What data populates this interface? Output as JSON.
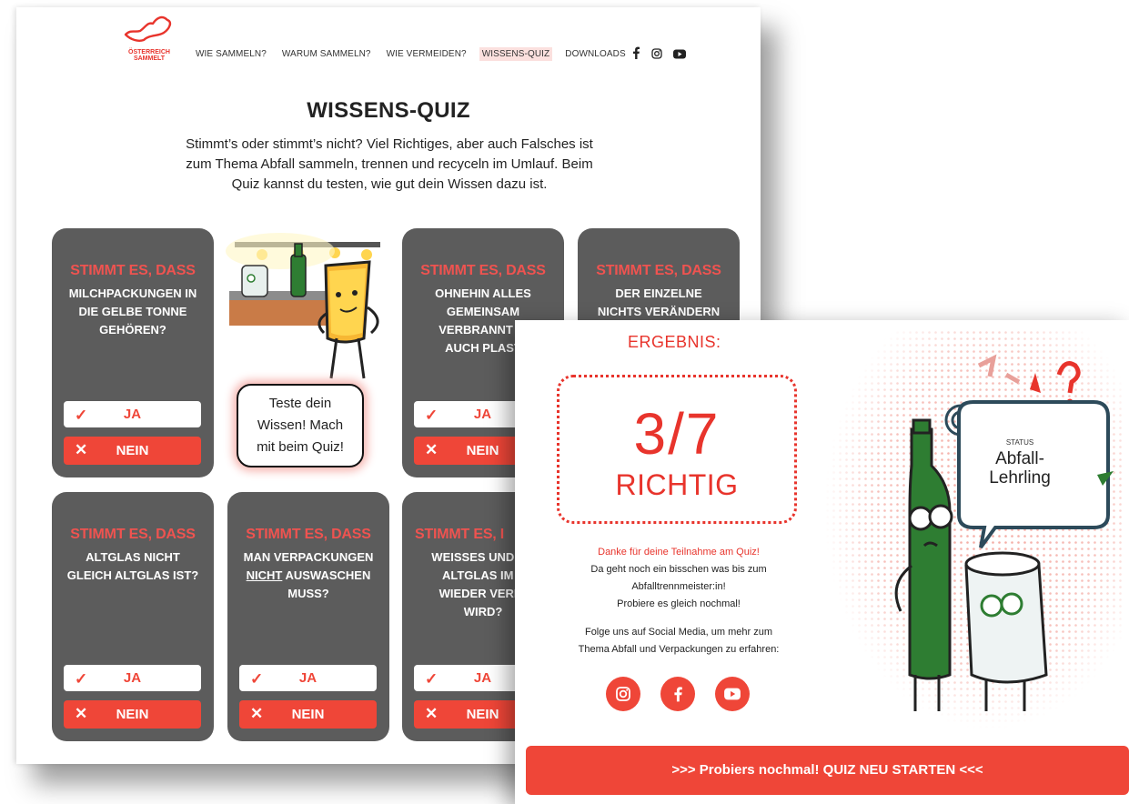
{
  "site": {
    "logo_text_line1": "ÖSTERREICH",
    "logo_text_line2": "SAMMELT",
    "nav": [
      {
        "label": "WIE SAMMELN?",
        "active": false
      },
      {
        "label": "WARUM SAMMELN?",
        "active": false
      },
      {
        "label": "WIE VERMEIDEN?",
        "active": false
      },
      {
        "label": "WISSENS-QUIZ",
        "active": true
      },
      {
        "label": "DOWNLOADS",
        "active": false
      }
    ],
    "social_icons": [
      "facebook-icon",
      "instagram-icon",
      "youtube-icon"
    ]
  },
  "page": {
    "title": "WISSENS-QUIZ",
    "intro_lines": [
      "Stimmt’s oder stimmt’s nicht? Viel Richtiges, aber auch Falsches ist",
      "zum Thema Abfall sammeln, trennen und recyceln im Umlauf. Beim",
      "Quiz kannst du testen, wie gut dein Wissen dazu ist."
    ],
    "kicker": "STIMMT ES, DASS",
    "yes_label": "JA",
    "no_label": "NEIN",
    "cards": [
      {
        "lines": [
          "MILCHPACKUNGEN IN",
          "DIE GELBE TONNE",
          "GEHÖREN?"
        ]
      },
      {
        "lines": [
          "OHNEHIN ALLES",
          "GEMEINSAM",
          "VERBRANNT W",
          "AUCH PLAST"
        ]
      },
      {
        "lines": [
          "DER EINZELNE",
          "NICHTS VERÄNDERN"
        ]
      },
      {
        "lines": [
          "ALTGLAS NICHT",
          "GLEICH ALTGLAS IST?"
        ]
      },
      {
        "line1_underlined": "NICHT",
        "lines": [
          "MAN VERPACKUNGEN",
          " AUSWASCHEN",
          "MUSS?"
        ]
      },
      {
        "lines": [
          "WEISSES UND BU",
          "ALTGLAS IM L",
          "WIEDER VERMI",
          "WIRD?"
        ]
      }
    ],
    "kicker_partial": "STIMMT ES, I",
    "bubble_lines": [
      "Teste dein",
      "Wissen! Mach",
      "mit beim Quiz!"
    ]
  },
  "result": {
    "heading": "ERGEBNIS:",
    "score": "3/7",
    "score_label": "RICHTIG",
    "thanks": "Danke für deine Teilnahme am Quiz!",
    "msg_lines": [
      "Da geht noch ein bisschen was bis zum",
      "Abfalltrennmeister:in!",
      "Probiere es gleich nochmal!"
    ],
    "follow_lines": [
      "Folge uns auf Social Media, um mehr zum",
      "Thema Abfall und Verpackungen zu erfahren:"
    ],
    "social_icons": [
      "instagram-icon",
      "facebook-icon",
      "youtube-icon"
    ],
    "status_label": "STATUS",
    "status_value_line1": "Abfall-",
    "status_value_line2": "Lehrling",
    "cta": ">>> Probiers nochmal! QUIZ NEU STARTEN <<<"
  },
  "colors": {
    "accent": "#ef4638",
    "card": "#5c5c5c",
    "kicker": "#ef5350"
  }
}
